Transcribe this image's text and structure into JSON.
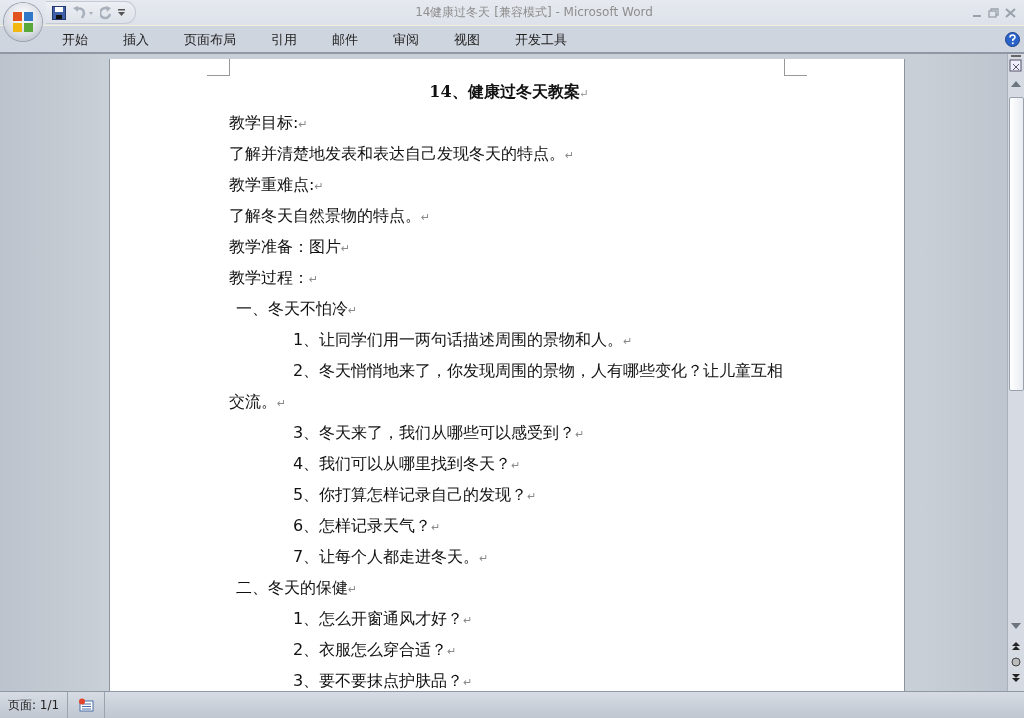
{
  "window": {
    "title": "14健康过冬天 [兼容模式] - Microsoft Word"
  },
  "ribbon_tabs": [
    {
      "label": "开始",
      "selected": false
    },
    {
      "label": "插入",
      "selected": false
    },
    {
      "label": "页面布局",
      "selected": false
    },
    {
      "label": "引用",
      "selected": false
    },
    {
      "label": "邮件",
      "selected": false
    },
    {
      "label": "审阅",
      "selected": false
    },
    {
      "label": "视图",
      "selected": false
    },
    {
      "label": "开发工具",
      "selected": false
    }
  ],
  "document": {
    "paragraph_mark": "↵",
    "lines": [
      {
        "kind": "heading",
        "text": "14、健康过冬天教案"
      },
      {
        "kind": "body",
        "text": "教学目标:"
      },
      {
        "kind": "body",
        "text": "了解并清楚地发表和表达自己发现冬天的特点。"
      },
      {
        "kind": "body",
        "text": "教学重难点:"
      },
      {
        "kind": "body",
        "text": "了解冬天自然景物的特点。"
      },
      {
        "kind": "body",
        "text": "教学准备：图片"
      },
      {
        "kind": "body",
        "text": "教学过程："
      },
      {
        "kind": "section",
        "text": "一、冬天不怕冷"
      },
      {
        "kind": "item",
        "text": "1、让同学们用一两句话描述周围的景物和人。"
      },
      {
        "kind": "item",
        "text": "2、冬天悄悄地来了，你发现周围的景物，人有哪些变化？让儿童互相交流。"
      },
      {
        "kind": "item",
        "text": "3、冬天来了，我们从哪些可以感受到？"
      },
      {
        "kind": "item",
        "text": "4、我们可以从哪里找到冬天？"
      },
      {
        "kind": "item",
        "text": "5、你打算怎样记录自己的发现？"
      },
      {
        "kind": "item",
        "text": "6、怎样记录天气？"
      },
      {
        "kind": "item",
        "text": "7、让每个人都走进冬天。"
      },
      {
        "kind": "section",
        "text": "二、冬天的保健"
      },
      {
        "kind": "item",
        "text": "1、怎么开窗通风才好？"
      },
      {
        "kind": "item",
        "text": "2、衣服怎么穿合适？"
      },
      {
        "kind": "item",
        "text": "3、要不要抹点护肤品？"
      }
    ]
  },
  "status_bar": {
    "page": "页面: 1/1"
  }
}
